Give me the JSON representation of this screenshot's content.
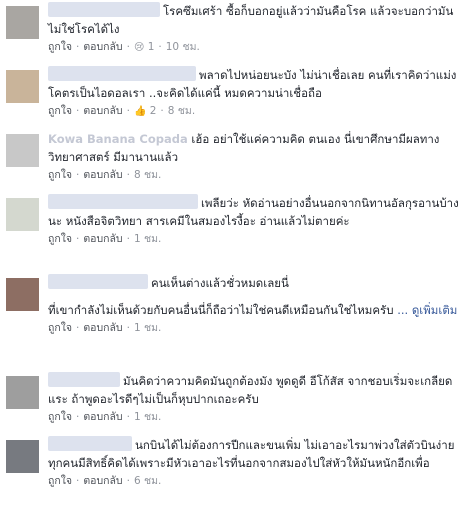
{
  "actions": {
    "like": "ถูกใจ",
    "reply": "ตอบกลับ",
    "sep": "·"
  },
  "comments": [
    {
      "text": "โรคซึมเศร้า ซื้อก็บอกอยู่แล้วว่ามันคือโรค แล้วจะบอกว่ามันไม่ใช่โรคได้ไง",
      "reaction": "😢",
      "reaction_count": "1",
      "time": "10 ชม."
    },
    {
      "text": "พลาดไปหน่อยนะบัง ไม่น่าเชื่อเลย คนที่เราคิดว่าแม่งโคตรเป็นไอดอลเรา ..จะคิดได้แค่นี้ หมดความน่าเชื่อถือ",
      "reaction": "👍",
      "reaction_count": "2",
      "time": "8 ชม."
    },
    {
      "name": "Kowa Banana Copada",
      "text": "เฮ้อ อย่าใช้แค่ความคิด ตนเอง นี่เขาศึกษามีผลทางวิทยาศาสตร์ มีมานานแล้ว",
      "time": "8 ชม."
    },
    {
      "text": "เพลียว่ะ หัดอ่านอย่างอื่นนอกจากนิทานอัลกุรอานบ้างนะ หนังสือจิตวิทยา สารเคมีในสมองไรงี้อะ อ่านแล้วไม่ตายค่ะ",
      "time": "1 ชม."
    },
    {
      "text": "คนเห็นต่างแล้วชั่วหมดเลยนี่",
      "text2": "ที่เขากำลังไม่เห็นด้วยกับคนอื่นนี่ก็ถือว่าไม่ใช่คนดีเหมือนกันใช่ไหมครับ",
      "more": "... ดูเพิ่มเติม",
      "time": "1 ชม."
    },
    {
      "text": "มันคิดว่าความคิดมันถูกต้องมัง พูดดูดี อีโก้สัส จากชอบเริ่มจะเกลียดแระ ถ้าพูดอะไรดีๆไม่เป็นก็หุบปากเถอะครับ",
      "time": "1 ชม."
    },
    {
      "text": "นกบินได้ไม่ต้องการปีกและขนเพิ่ม ไม่เอาอะไรมาพ่วงใส่ตัวบินง่ายทุกคนมีสิทธิ์คิดได้เพราะมีหัวเอาอะไรที่นอกจากสมองไปใส่หัวให้มันหนักอีกเพื่อ",
      "time": "6 ชม."
    }
  ],
  "colors": {
    "link": "#365899",
    "meta": "#90949c",
    "text": "#1d2129"
  }
}
